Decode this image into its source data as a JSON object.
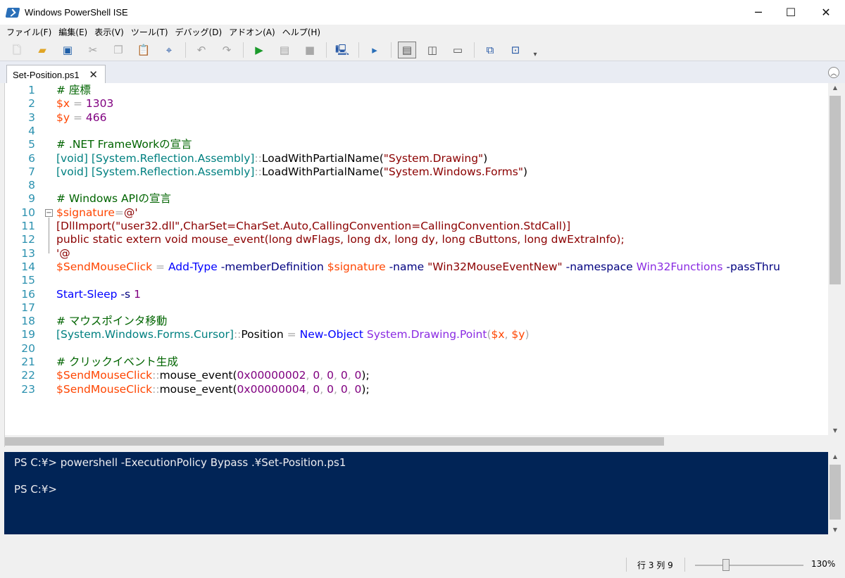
{
  "window": {
    "title": "Windows PowerShell ISE",
    "minimize_glyph": "─",
    "maximize_glyph": "☐",
    "close_glyph": "✕"
  },
  "menu": [
    "ファイル(F)",
    "編集(E)",
    "表示(V)",
    "ツール(T)",
    "デバッグ(D)",
    "アドオン(A)",
    "ヘルプ(H)"
  ],
  "toolbar": {
    "buttons": [
      {
        "name": "new-icon",
        "glyph": "🗋",
        "color": "#ffffff"
      },
      {
        "name": "open-icon",
        "glyph": "▰",
        "color": "#e0a526"
      },
      {
        "name": "save-icon",
        "glyph": "▣",
        "color": "#1f5fa8"
      },
      {
        "name": "cut-icon",
        "glyph": "✂",
        "color": "#a0a0a0"
      },
      {
        "name": "copy-icon",
        "glyph": "❐",
        "color": "#b0b0b0"
      },
      {
        "name": "paste-icon",
        "glyph": "📋",
        "color": "#404040"
      },
      {
        "name": "clear-console-icon",
        "glyph": "⌖",
        "color": "#2456a4"
      },
      {
        "name": "undo-icon",
        "glyph": "↶",
        "color": "#a0a0a0"
      },
      {
        "name": "redo-icon",
        "glyph": "↷",
        "color": "#a0a0a0"
      },
      {
        "name": "run-icon",
        "glyph": "▶",
        "color": "#1b9a2b"
      },
      {
        "name": "run-selection-icon",
        "glyph": "▤",
        "color": "#a0a0a0"
      },
      {
        "name": "stop-icon",
        "glyph": "■",
        "color": "#a8a8a8"
      },
      {
        "name": "remote-tab-icon",
        "glyph": "🖳",
        "color": "#2456a4"
      },
      {
        "name": "powershell-console-icon",
        "glyph": "▸",
        "color": "#2a6fb8"
      },
      {
        "name": "show-script-top-icon",
        "glyph": "▤",
        "color": "#505050"
      },
      {
        "name": "show-script-right-icon",
        "glyph": "◫",
        "color": "#505050"
      },
      {
        "name": "show-script-max-icon",
        "glyph": "▭",
        "color": "#505050"
      },
      {
        "name": "command-addon-icon",
        "glyph": "⧉",
        "color": "#2456a4"
      },
      {
        "name": "show-command-window-icon",
        "glyph": "⊡",
        "color": "#2456a4"
      },
      {
        "name": "toolbar-overflow-icon",
        "glyph": "▾",
        "color": "#505050"
      }
    ]
  },
  "tab": {
    "label": "Set-Position.ps1",
    "close_glyph": "✕",
    "collapse_glyph": "︿"
  },
  "editor": {
    "lines": [
      {
        "n": "1",
        "tokens": [
          {
            "t": "# 座標",
            "c": "c-comment"
          }
        ]
      },
      {
        "n": "2",
        "tokens": [
          {
            "t": "$x",
            "c": "c-var"
          },
          {
            "t": " = ",
            "c": "c-op"
          },
          {
            "t": "1303",
            "c": "c-num"
          }
        ]
      },
      {
        "n": "3",
        "tokens": [
          {
            "t": "$y",
            "c": "c-var"
          },
          {
            "t": " = ",
            "c": "c-op"
          },
          {
            "t": "466",
            "c": "c-num"
          }
        ]
      },
      {
        "n": "4",
        "tokens": []
      },
      {
        "n": "5",
        "tokens": [
          {
            "t": "# .NET FrameWorkの宣言",
            "c": "c-comment"
          }
        ]
      },
      {
        "n": "6",
        "tokens": [
          {
            "t": "[void]",
            "c": "c-type"
          },
          {
            "t": " ",
            "c": "c-op"
          },
          {
            "t": "[System.Reflection.Assembly]",
            "c": "c-type"
          },
          {
            "t": "::",
            "c": "c-op"
          },
          {
            "t": "LoadWithPartialName(",
            "c": "c-member"
          },
          {
            "t": "\"System.Drawing\"",
            "c": "c-str"
          },
          {
            "t": ")",
            "c": "c-member"
          }
        ]
      },
      {
        "n": "7",
        "tokens": [
          {
            "t": "[void]",
            "c": "c-type"
          },
          {
            "t": " ",
            "c": "c-op"
          },
          {
            "t": "[System.Reflection.Assembly]",
            "c": "c-type"
          },
          {
            "t": "::",
            "c": "c-op"
          },
          {
            "t": "LoadWithPartialName(",
            "c": "c-member"
          },
          {
            "t": "\"System.Windows.Forms\"",
            "c": "c-str"
          },
          {
            "t": ")",
            "c": "c-member"
          }
        ]
      },
      {
        "n": "8",
        "tokens": []
      },
      {
        "n": "9",
        "tokens": [
          {
            "t": "# Windows APIの宣言",
            "c": "c-comment"
          }
        ]
      },
      {
        "n": "10",
        "tokens": [
          {
            "t": "$signature",
            "c": "c-var"
          },
          {
            "t": "=",
            "c": "c-op"
          },
          {
            "t": "@'",
            "c": "c-here"
          }
        ]
      },
      {
        "n": "11",
        "tokens": [
          {
            "t": "[DllImport(\"user32.dll\",CharSet=CharSet.Auto,CallingConvention=CallingConvention.StdCall)]",
            "c": "c-here"
          }
        ]
      },
      {
        "n": "12",
        "tokens": [
          {
            "t": "public static extern void mouse_event(long dwFlags, long dx, long dy, long cButtons, long dwExtraInfo);",
            "c": "c-here"
          }
        ]
      },
      {
        "n": "13",
        "tokens": [
          {
            "t": "'@",
            "c": "c-here"
          }
        ]
      },
      {
        "n": "14",
        "tokens": [
          {
            "t": "$SendMouseClick",
            "c": "c-var"
          },
          {
            "t": " = ",
            "c": "c-op"
          },
          {
            "t": "Add-Type",
            "c": "c-cmd"
          },
          {
            "t": " ",
            "c": "c-op"
          },
          {
            "t": "-memberDefinition",
            "c": "c-param"
          },
          {
            "t": " ",
            "c": "c-op"
          },
          {
            "t": "$signature",
            "c": "c-var"
          },
          {
            "t": " ",
            "c": "c-op"
          },
          {
            "t": "-name",
            "c": "c-param"
          },
          {
            "t": " ",
            "c": "c-op"
          },
          {
            "t": "\"Win32MouseEventNew\"",
            "c": "c-str"
          },
          {
            "t": " ",
            "c": "c-op"
          },
          {
            "t": "-namespace",
            "c": "c-param"
          },
          {
            "t": " ",
            "c": "c-op"
          },
          {
            "t": "Win32Functions",
            "c": "c-arg"
          },
          {
            "t": " ",
            "c": "c-op"
          },
          {
            "t": "-passThru",
            "c": "c-param"
          }
        ]
      },
      {
        "n": "15",
        "tokens": []
      },
      {
        "n": "16",
        "tokens": [
          {
            "t": "Start-Sleep",
            "c": "c-cmd"
          },
          {
            "t": " ",
            "c": "c-op"
          },
          {
            "t": "-s",
            "c": "c-param"
          },
          {
            "t": " ",
            "c": "c-op"
          },
          {
            "t": "1",
            "c": "c-num"
          }
        ]
      },
      {
        "n": "17",
        "tokens": []
      },
      {
        "n": "18",
        "tokens": [
          {
            "t": "# マウスポインタ移動",
            "c": "c-comment"
          }
        ]
      },
      {
        "n": "19",
        "tokens": [
          {
            "t": "[System.Windows.Forms.Cursor]",
            "c": "c-type"
          },
          {
            "t": "::",
            "c": "c-op"
          },
          {
            "t": "Position",
            "c": "c-member"
          },
          {
            "t": " = ",
            "c": "c-op"
          },
          {
            "t": "New-Object",
            "c": "c-cmd"
          },
          {
            "t": " ",
            "c": "c-op"
          },
          {
            "t": "System.Drawing.Point",
            "c": "c-arg"
          },
          {
            "t": "(",
            "c": "c-op"
          },
          {
            "t": "$x",
            "c": "c-var"
          },
          {
            "t": ", ",
            "c": "c-op"
          },
          {
            "t": "$y",
            "c": "c-var"
          },
          {
            "t": ")",
            "c": "c-op"
          }
        ]
      },
      {
        "n": "20",
        "tokens": []
      },
      {
        "n": "21",
        "tokens": [
          {
            "t": "# クリックイベント生成",
            "c": "c-comment"
          }
        ]
      },
      {
        "n": "22",
        "tokens": [
          {
            "t": "$SendMouseClick",
            "c": "c-var"
          },
          {
            "t": "::",
            "c": "c-op"
          },
          {
            "t": "mouse_event(",
            "c": "c-member"
          },
          {
            "t": "0x00000002",
            "c": "c-num"
          },
          {
            "t": ", ",
            "c": "c-op"
          },
          {
            "t": "0",
            "c": "c-num"
          },
          {
            "t": ", ",
            "c": "c-op"
          },
          {
            "t": "0",
            "c": "c-num"
          },
          {
            "t": ", ",
            "c": "c-op"
          },
          {
            "t": "0",
            "c": "c-num"
          },
          {
            "t": ", ",
            "c": "c-op"
          },
          {
            "t": "0",
            "c": "c-num"
          },
          {
            "t": ");",
            "c": "c-member"
          }
        ]
      },
      {
        "n": "23",
        "tokens": [
          {
            "t": "$SendMouseClick",
            "c": "c-var"
          },
          {
            "t": "::",
            "c": "c-op"
          },
          {
            "t": "mouse_event(",
            "c": "c-member"
          },
          {
            "t": "0x00000004",
            "c": "c-num"
          },
          {
            "t": ", ",
            "c": "c-op"
          },
          {
            "t": "0",
            "c": "c-num"
          },
          {
            "t": ", ",
            "c": "c-op"
          },
          {
            "t": "0",
            "c": "c-num"
          },
          {
            "t": ", ",
            "c": "c-op"
          },
          {
            "t": "0",
            "c": "c-num"
          },
          {
            "t": ", ",
            "c": "c-op"
          },
          {
            "t": "0",
            "c": "c-num"
          },
          {
            "t": ");",
            "c": "c-member"
          }
        ]
      }
    ],
    "fold_glyph": "−"
  },
  "console": {
    "lines": [
      "PS C:¥> powershell -ExecutionPolicy Bypass .¥Set-Position.ps1",
      "",
      "PS C:¥>"
    ],
    "background": "#012456"
  },
  "status": {
    "position": "行 3 列 9",
    "zoom": "130%"
  }
}
